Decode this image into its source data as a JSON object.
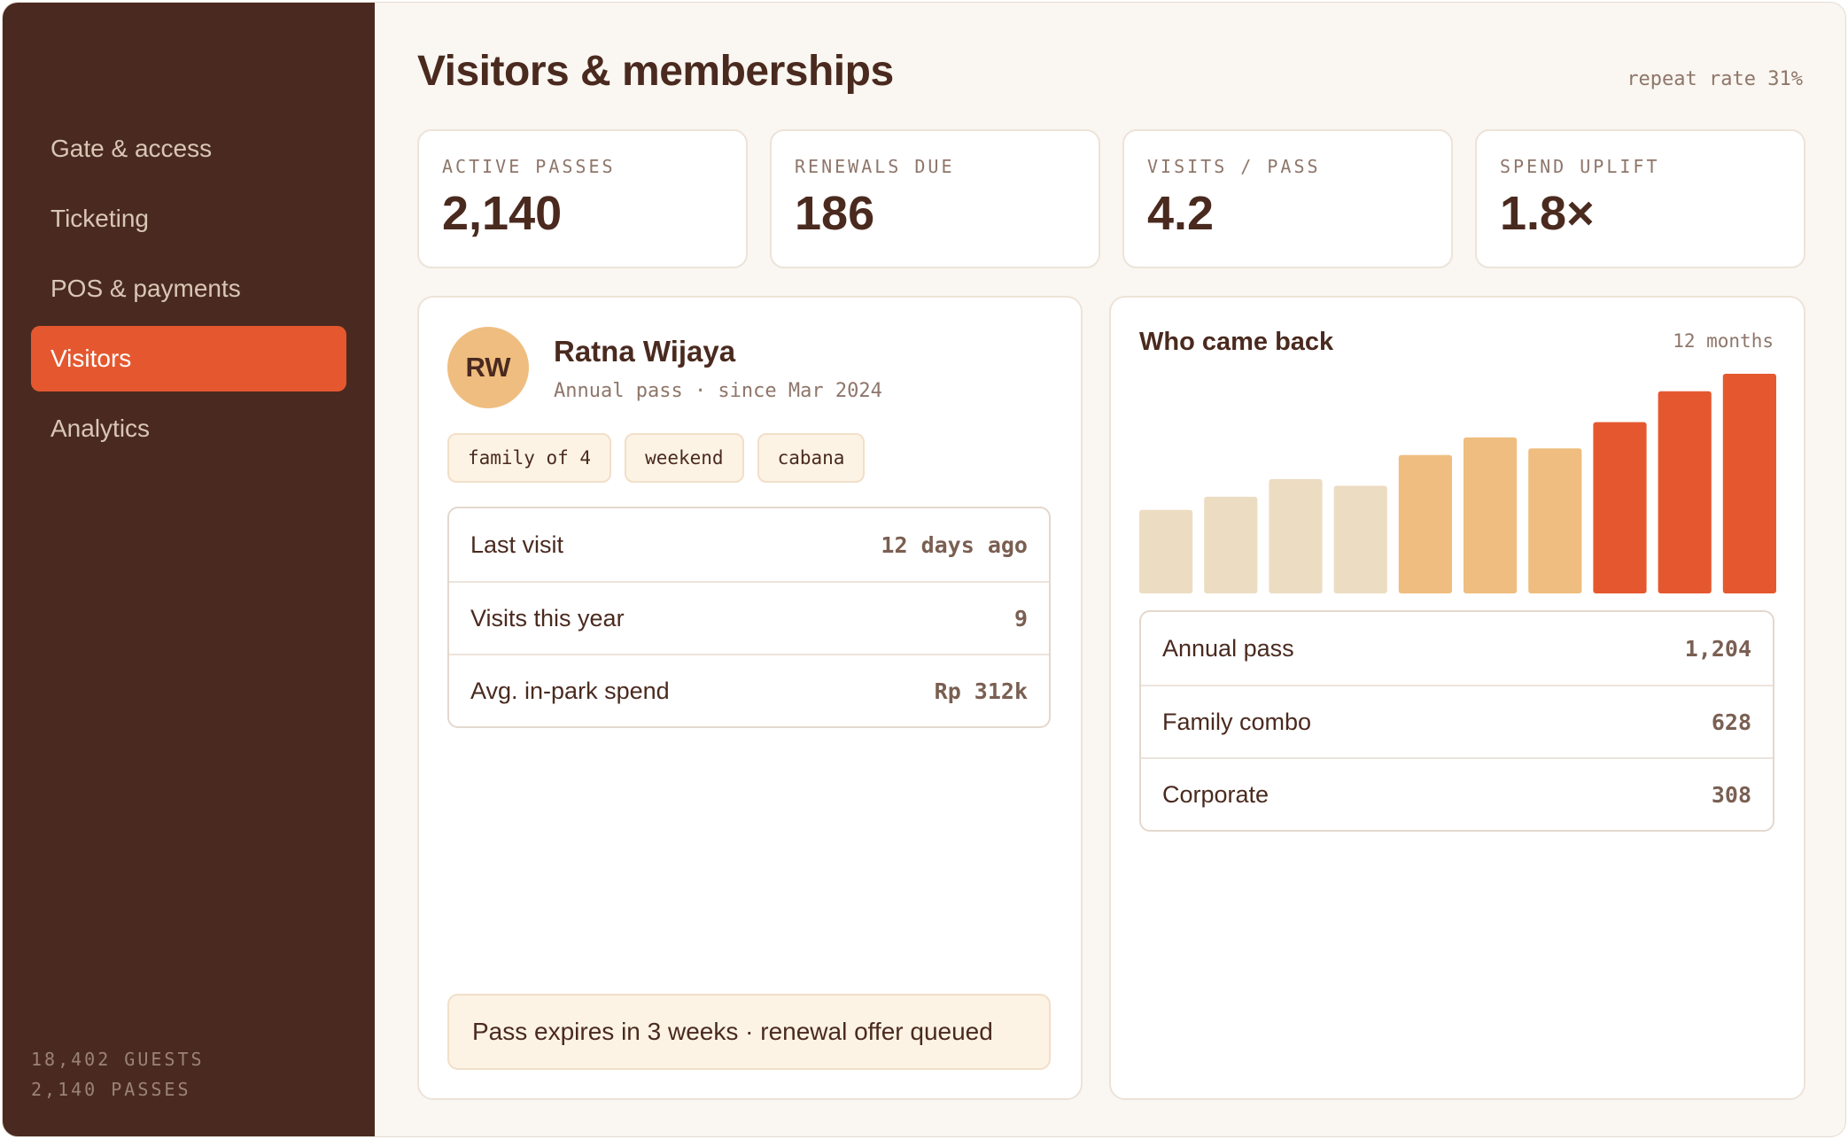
{
  "sidebar": {
    "items": [
      {
        "label": "Gate & access",
        "active": false
      },
      {
        "label": "Ticketing",
        "active": false
      },
      {
        "label": "POS & payments",
        "active": false
      },
      {
        "label": "Visitors",
        "active": true
      },
      {
        "label": "Analytics",
        "active": false
      }
    ],
    "footer": {
      "guests": "18,402 GUESTS",
      "passes": "2,140 PASSES"
    }
  },
  "header": {
    "title": "Visitors & memberships",
    "repeat_rate": "repeat rate 31%"
  },
  "kpis": [
    {
      "label": "ACTIVE PASSES",
      "value": "2,140"
    },
    {
      "label": "RENEWALS DUE",
      "value": "186"
    },
    {
      "label": "VISITS / PASS",
      "value": "4.2"
    },
    {
      "label": "SPEND UPLIFT",
      "value": "1.8×"
    }
  ],
  "profile": {
    "initials": "RW",
    "name": "Ratna Wijaya",
    "subtitle": "Annual pass · since Mar 2024",
    "tags": [
      "family of 4",
      "weekend",
      "cabana"
    ],
    "stats": [
      {
        "label": "Last visit",
        "value": "12 days ago"
      },
      {
        "label": "Visits this year",
        "value": "9"
      },
      {
        "label": "Avg. in-park spend",
        "value": "Rp 312k"
      }
    ],
    "notice": "Pass expires in 3 weeks · renewal offer queued"
  },
  "returns": {
    "title": "Who came back",
    "range": "12 months",
    "breakdown": [
      {
        "label": "Annual pass",
        "value": "1,204"
      },
      {
        "label": "Family combo",
        "value": "628"
      },
      {
        "label": "Corporate",
        "value": "308"
      }
    ]
  },
  "colors": {
    "accent": "#e5582f",
    "sidebar": "#4a2a20",
    "bar_low": "#ecdcc1",
    "bar_mid": "#efbd7f",
    "bar_high": "#e5582f"
  },
  "chart_data": {
    "type": "bar",
    "title": "Who came back",
    "values": [
      0.38,
      0.44,
      0.52,
      0.49,
      0.63,
      0.71,
      0.66,
      0.78,
      0.92,
      1.0
    ],
    "value_units": "relative height (no axis shown)",
    "color_groups": [
      "low",
      "low",
      "low",
      "low",
      "mid",
      "mid",
      "mid",
      "high",
      "high",
      "high"
    ],
    "ylim": [
      0,
      1
    ]
  }
}
